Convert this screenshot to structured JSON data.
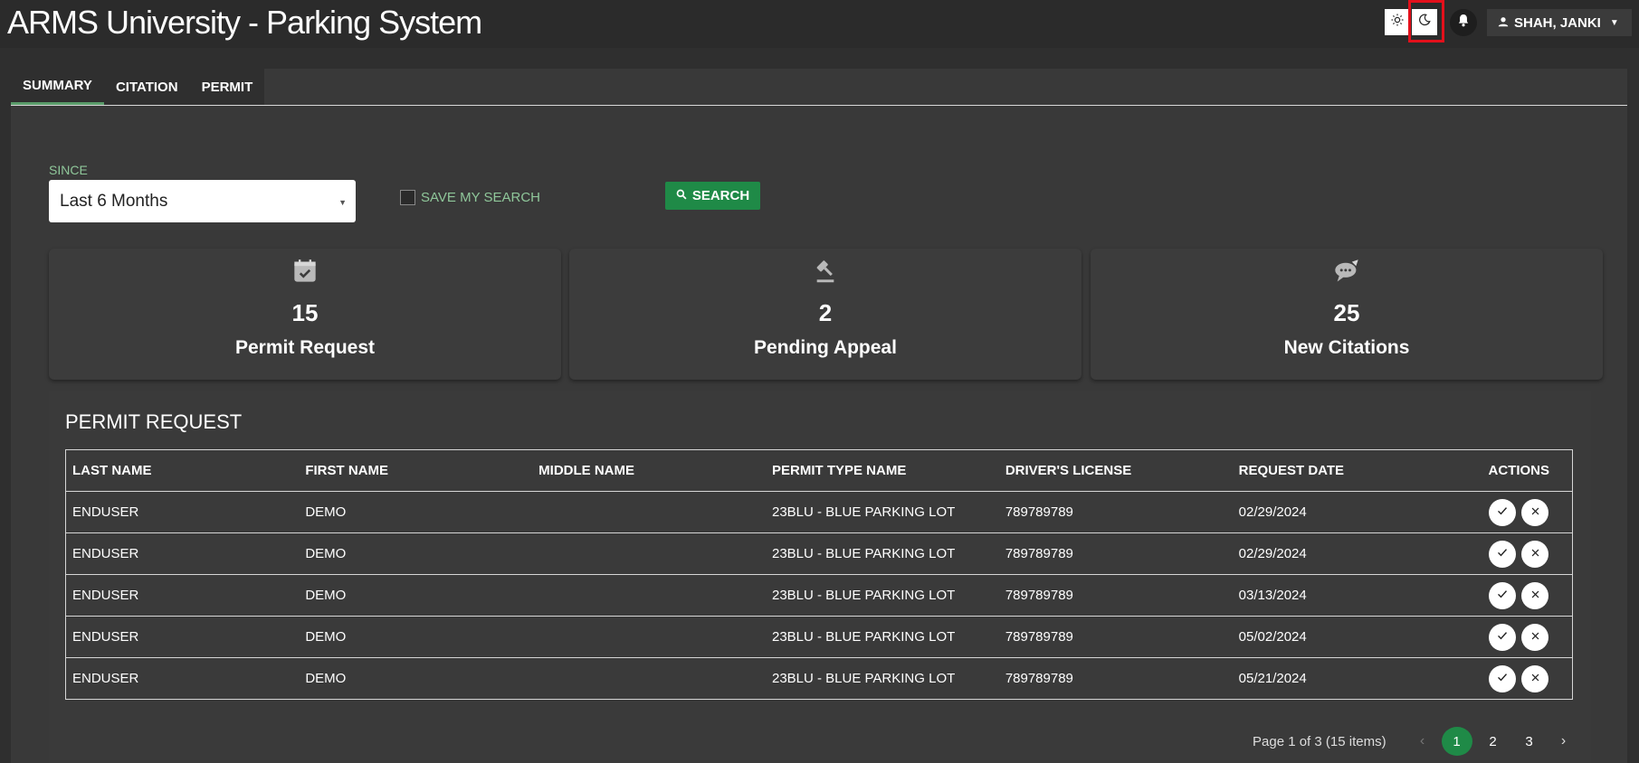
{
  "header": {
    "title": "ARMS University - Parking System",
    "user_name": "SHAH, JANKI",
    "icons": [
      "sun-icon",
      "moon-icon",
      "bell-icon",
      "user-icon"
    ]
  },
  "tabs": [
    {
      "label": "SUMMARY",
      "active": true
    },
    {
      "label": "CITATION",
      "active": false
    },
    {
      "label": "PERMIT",
      "active": false
    }
  ],
  "filters": {
    "since_label": "SINCE",
    "since_value": "Last 6 Months",
    "save_search_label": "SAVE MY SEARCH",
    "save_search_checked": false,
    "search_label": "SEARCH"
  },
  "summary_cards": [
    {
      "icon": "calendar-check-icon",
      "count": "15",
      "label": "Permit Request"
    },
    {
      "icon": "gavel-icon",
      "count": "2",
      "label": "Pending Appeal"
    },
    {
      "icon": "speech-bubble-icon",
      "count": "25",
      "label": "New Citations"
    }
  ],
  "permit_request": {
    "title": "PERMIT REQUEST",
    "columns": [
      "LAST NAME",
      "FIRST NAME",
      "MIDDLE NAME",
      "PERMIT TYPE NAME",
      "DRIVER'S LICENSE",
      "REQUEST DATE",
      "ACTIONS"
    ],
    "rows": [
      {
        "last": "ENDUSER",
        "first": "DEMO",
        "middle": "",
        "permit": "23BLU - BLUE PARKING LOT",
        "license": "789789789",
        "date": "02/29/2024"
      },
      {
        "last": "ENDUSER",
        "first": "DEMO",
        "middle": "",
        "permit": "23BLU - BLUE PARKING LOT",
        "license": "789789789",
        "date": "02/29/2024"
      },
      {
        "last": "ENDUSER",
        "first": "DEMO",
        "middle": "",
        "permit": "23BLU - BLUE PARKING LOT",
        "license": "789789789",
        "date": "03/13/2024"
      },
      {
        "last": "ENDUSER",
        "first": "DEMO",
        "middle": "",
        "permit": "23BLU - BLUE PARKING LOT",
        "license": "789789789",
        "date": "05/02/2024"
      },
      {
        "last": "ENDUSER",
        "first": "DEMO",
        "middle": "",
        "permit": "23BLU - BLUE PARKING LOT",
        "license": "789789789",
        "date": "05/21/2024"
      }
    ],
    "pager": {
      "info": "Page 1 of 3 (15 items)",
      "pages": [
        "1",
        "2",
        "3"
      ],
      "current": "1"
    }
  },
  "colors": {
    "accent_green": "#1f8a47",
    "label_green": "#8fc79a",
    "highlight_red": "#e3101b"
  }
}
